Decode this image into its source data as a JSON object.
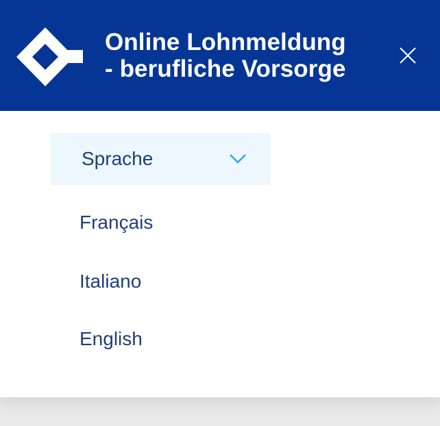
{
  "header": {
    "title_line1": "Online Lohnmeldung",
    "title_line2": "- berufliche Vorsorge",
    "logo": "company-logo-icon",
    "close_icon": "close-icon"
  },
  "language_menu": {
    "toggle_label": "Sprache",
    "chevron_icon": "chevron-down-icon",
    "options": [
      "Français",
      "Italiano",
      "English"
    ]
  },
  "colors": {
    "header_bg": "#063695",
    "toggle_bg": "#edf7fd",
    "text": "#1f3f7a",
    "chevron": "#26a7ef"
  }
}
